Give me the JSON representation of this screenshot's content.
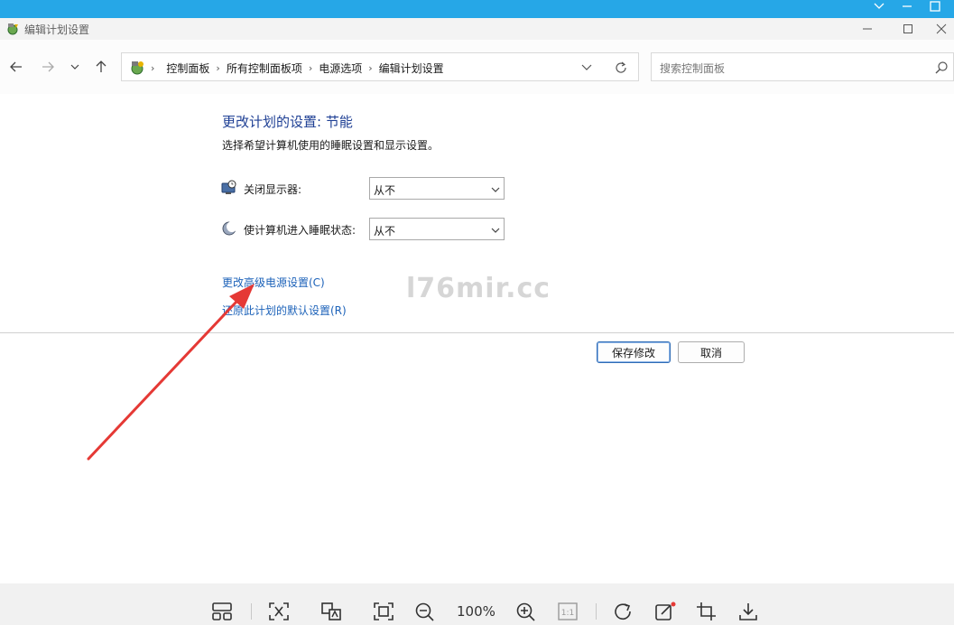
{
  "window": {
    "title": "编辑计划设置"
  },
  "nav": {
    "breadcrumb": [
      "控制面板",
      "所有控制面板项",
      "电源选项",
      "编辑计划设置"
    ],
    "search_placeholder": "搜索控制面板"
  },
  "main": {
    "heading": "更改计划的设置: 节能",
    "description": "选择希望计算机使用的睡眠设置和显示设置。",
    "display_off_label": "关闭显示器:",
    "display_off_value": "从不",
    "sleep_label": "使计算机进入睡眠状态:",
    "sleep_value": "从不",
    "advanced_link": "更改高级电源设置(C)",
    "restore_link": "还原此计划的默认设置(R)",
    "save_label": "保存修改",
    "cancel_label": "取消"
  },
  "watermark": "l76mir.cc",
  "viewer": {
    "zoom": "100%"
  },
  "colors": {
    "accent_bar": "#26a7e7",
    "heading": "#1e3f94",
    "link": "#1c62b9",
    "annotation_arrow": "#e53935"
  }
}
